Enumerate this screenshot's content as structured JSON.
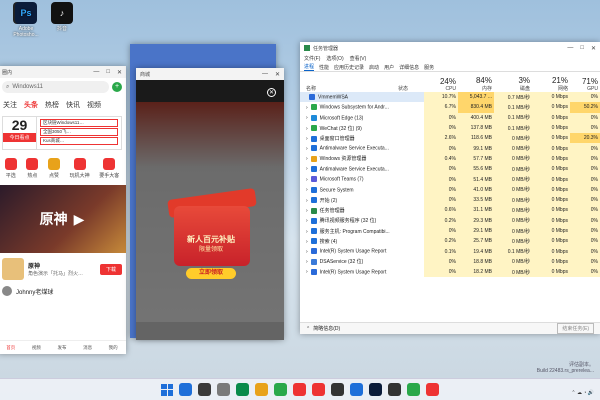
{
  "desktop": {
    "icons": [
      {
        "label": "",
        "color": "#222"
      },
      {
        "label": "Adobe Photosho...",
        "short": "Ps",
        "color": "#0b1c3a"
      },
      {
        "label": "抖音",
        "short": "♪",
        "color": "#111"
      }
    ]
  },
  "news_window": {
    "title": "圈内",
    "search": "Windows11",
    "tabs": [
      "关注",
      "头条",
      "热榜",
      "快讯",
      "视频"
    ],
    "date_day": "29",
    "date_tag": "今日看点",
    "headlines": [
      "区块链Windows11…",
      "全国3050飞…",
      "Kus商城…"
    ],
    "quick_links": [
      "平选",
      "热点",
      "点赞",
      "玩机大神",
      "要手大客"
    ],
    "banner_text": "原神",
    "game_name": "原神",
    "game_desc": "角色演示「托马」烈火…",
    "game_button": "下载",
    "user_row": "Johnny老煤球",
    "bottom_nav": [
      "首页",
      "视频",
      "发布",
      "消息",
      "我的"
    ]
  },
  "shop_window": {
    "title": "商城",
    "promo_line1": "新人百元补贴",
    "promo_line2": "限量领取",
    "promo_cta": "立即领取"
  },
  "taskmgr": {
    "title": "任务管理器",
    "menu": [
      "文件(F)",
      "选项(O)",
      "查看(V)"
    ],
    "tabs": [
      "进程",
      "性能",
      "应用历史记录",
      "启动",
      "用户",
      "详细信息",
      "服务"
    ],
    "col_name": "名称",
    "col_status": "状态",
    "cols": [
      {
        "pct": "24%",
        "label": "CPU"
      },
      {
        "pct": "84%",
        "label": "内存"
      },
      {
        "pct": "3%",
        "label": "磁盘"
      },
      {
        "pct": "21%",
        "label": "网络"
      },
      {
        "pct": "71%",
        "label": "GPU"
      }
    ],
    "rows": [
      {
        "name": "VmmemWSA",
        "cpu": "10.7%",
        "mem": "5,043.7 ...",
        "disk": "0.7 MB/秒",
        "net": "0 Mbps",
        "gpu": "0%"
      },
      {
        "name": "Windows Subsystem for Andr...",
        "cpu": "6.7%",
        "mem": "830.4 MB",
        "disk": "0.1 MB/秒",
        "net": "0 Mbps",
        "gpu": "50.2%"
      },
      {
        "name": "Microsoft Edge (13)",
        "cpu": "0%",
        "mem": "400.4 MB",
        "disk": "0.1 MB/秒",
        "net": "0 Mbps",
        "gpu": "0%"
      },
      {
        "name": "WeChat (32 位) (9)",
        "cpu": "0%",
        "mem": "137.8 MB",
        "disk": "0.1 MB/秒",
        "net": "0 Mbps",
        "gpu": "0%"
      },
      {
        "name": "桌面窗口管理器",
        "cpu": "2.6%",
        "mem": "118.6 MB",
        "disk": "0 MB/秒",
        "net": "0 Mbps",
        "gpu": "20.3%"
      },
      {
        "name": "Antimalware Service Executa...",
        "cpu": "0%",
        "mem": "99.1 MB",
        "disk": "0 MB/秒",
        "net": "0 Mbps",
        "gpu": "0%"
      },
      {
        "name": "Windows 资源管理器",
        "cpu": "0.4%",
        "mem": "57.7 MB",
        "disk": "0 MB/秒",
        "net": "0 Mbps",
        "gpu": "0%"
      },
      {
        "name": "Antimalware Service Executa...",
        "cpu": "0%",
        "mem": "55.6 MB",
        "disk": "0 MB/秒",
        "net": "0 Mbps",
        "gpu": "0%"
      },
      {
        "name": "Microsoft Teams (7)",
        "cpu": "0%",
        "mem": "51.4 MB",
        "disk": "0 MB/秒",
        "net": "0 Mbps",
        "gpu": "0%"
      },
      {
        "name": "Secure System",
        "cpu": "0%",
        "mem": "41.0 MB",
        "disk": "0 MB/秒",
        "net": "0 Mbps",
        "gpu": "0%"
      },
      {
        "name": "开始 (2)",
        "cpu": "0%",
        "mem": "33.5 MB",
        "disk": "0 MB/秒",
        "net": "0 Mbps",
        "gpu": "0%"
      },
      {
        "name": "任务管理器",
        "cpu": "0.6%",
        "mem": "31.1 MB",
        "disk": "0 MB/秒",
        "net": "0 Mbps",
        "gpu": "0%"
      },
      {
        "name": "腾讯视频服务程序 (32 位)",
        "cpu": "0.2%",
        "mem": "29.3 MB",
        "disk": "0 MB/秒",
        "net": "0 Mbps",
        "gpu": "0%"
      },
      {
        "name": "服务主机: Program Compatibi...",
        "cpu": "0%",
        "mem": "29.1 MB",
        "disk": "0 MB/秒",
        "net": "0 Mbps",
        "gpu": "0%"
      },
      {
        "name": "搜索 (4)",
        "cpu": "0.2%",
        "mem": "25.7 MB",
        "disk": "0 MB/秒",
        "net": "0 Mbps",
        "gpu": "0%"
      },
      {
        "name": "Intel(R) System Usage Report",
        "cpu": "0.1%",
        "mem": "19.4 MB",
        "disk": "0.1 MB/秒",
        "net": "0 Mbps",
        "gpu": "0%"
      },
      {
        "name": "DSAService (32 位)",
        "cpu": "0%",
        "mem": "18.8 MB",
        "disk": "0 MB/秒",
        "net": "0 Mbps",
        "gpu": "0%"
      },
      {
        "name": "Intel(R) System Usage Report",
        "cpu": "0%",
        "mem": "18.2 MB",
        "disk": "0 MB/秒",
        "net": "0 Mbps",
        "gpu": "0%"
      }
    ],
    "footer_less": "简略信息(D)",
    "footer_end": "结束任务(E)"
  },
  "watermark": [
    "评估副本。",
    "Build 22483.rs_prerelea..."
  ],
  "taskbar_icons": [
    "#1e6fd9",
    "#3a3a3a",
    "#7a7a7a",
    "#0a8a4a",
    "#e8a21a",
    "#2aa84a",
    "#e33",
    "#e33",
    "#333",
    "#1e6fd9",
    "#0b1c3a",
    "#333",
    "#2aa84a",
    "#e33"
  ]
}
